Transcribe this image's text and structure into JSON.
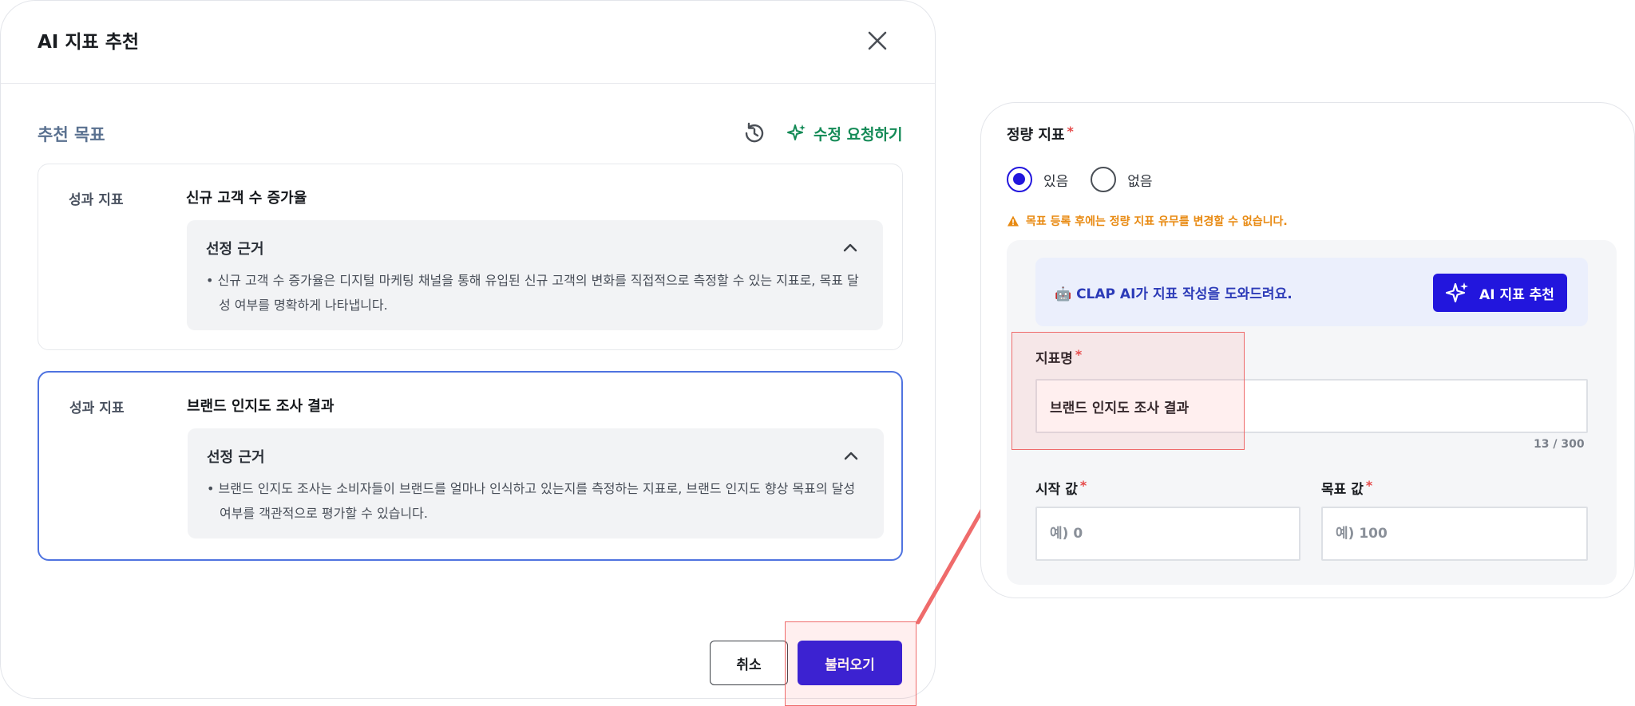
{
  "modal": {
    "title": "AI 지표 추천",
    "section_title": "추천 목표",
    "revise_label": "수정 요청하기",
    "cards": [
      {
        "label": "성과 지표",
        "name": "신규 고객 수 증가율",
        "reason_title": "선정 근거",
        "reason_text": "• 신규 고객 수 증가율은 디지털 마케팅 채널을 통해 유입된 신규 고객의 변화를 직접적으로 측정할 수 있는 지표로, 목표 달성 여부를 명확하게 나타냅니다."
      },
      {
        "label": "성과 지표",
        "name": "브랜드 인지도 조사 결과",
        "reason_title": "선정 근거",
        "reason_text": "• 브랜드 인지도 조사는 소비자들이 브랜드를 얼마나 인식하고 있는지를 측정하는 지표로, 브랜드 인지도 향상 목표의 달성 여부를 객관적으로 평가할 수 있습니다."
      }
    ],
    "cancel_label": "취소",
    "load_label": "불러오기"
  },
  "panel": {
    "quant_title": "정량 지표",
    "required_mark": "*",
    "radio_yes": "있음",
    "radio_no": "없음",
    "warning": "목표 등록 후에는 정량 지표 유무를 변경할 수 없습니다.",
    "ai_banner_text": "🤖 CLAP AI가 지표 작성을 도와드려요.",
    "ai_button_label": "AI 지표 추천",
    "name_label": "지표명",
    "name_value": "브랜드 인지도 조사 결과",
    "name_counter": "13 / 300",
    "start_label": "시작 값",
    "start_placeholder": "예) 0",
    "target_label": "목표 값",
    "target_placeholder": "예) 100"
  },
  "colors": {
    "primary": "#2216dd",
    "accent_green": "#138a56",
    "warning": "#e88a12",
    "required": "#e54848",
    "highlight": "#ef6b6b",
    "selected_border": "#4f73e0"
  }
}
